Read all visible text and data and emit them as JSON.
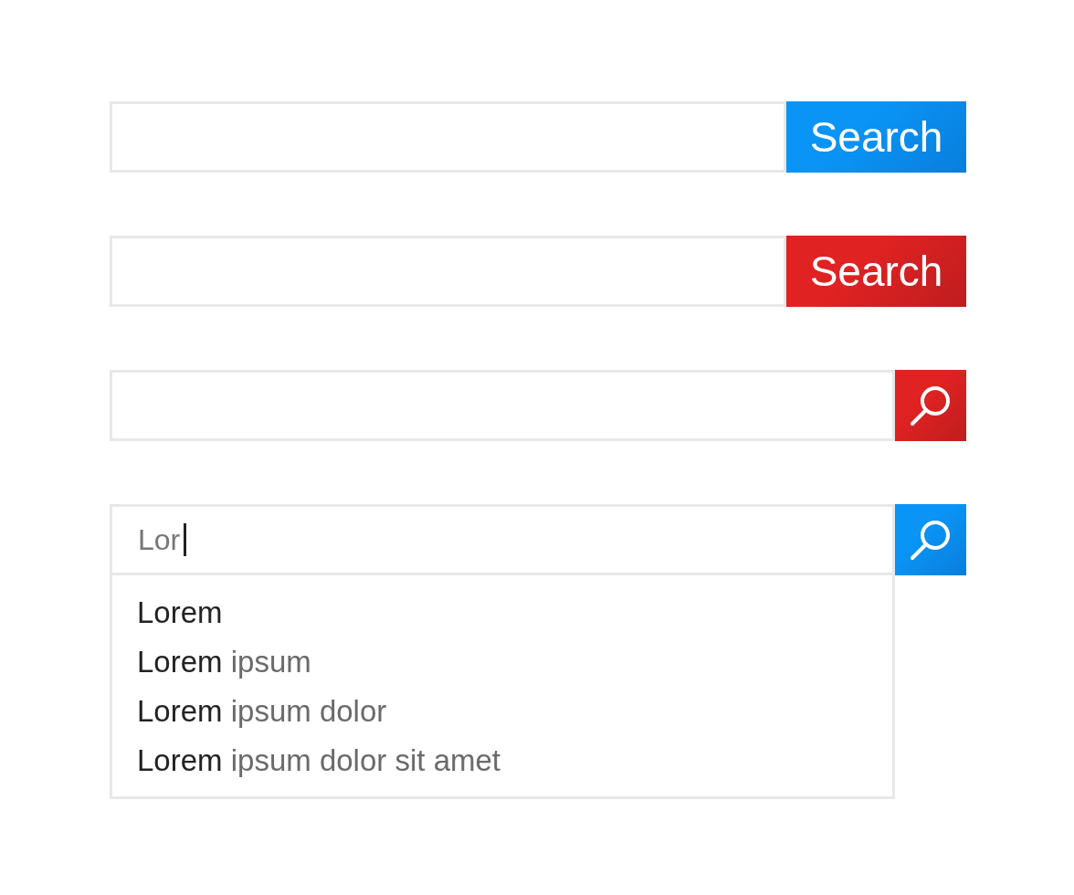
{
  "search_bars": [
    {
      "kind": "text",
      "button_label": "Search",
      "color": "#0a94f5",
      "focused": false
    },
    {
      "kind": "text",
      "button_label": "Search",
      "color": "#e02222",
      "focused": false
    },
    {
      "kind": "icon",
      "color": "#e02222",
      "focused": false
    },
    {
      "kind": "icon",
      "color": "#0a94f5",
      "focused": true,
      "value": "Lor",
      "suggestions": [
        {
          "match": "Lorem"
        },
        {
          "match": "Lorem",
          "rest": "ipsum"
        },
        {
          "match": "Lorem",
          "rest": "ipsum dolor"
        },
        {
          "match": "Lorem",
          "rest": "ipsum dolor sit amet"
        }
      ]
    }
  ]
}
